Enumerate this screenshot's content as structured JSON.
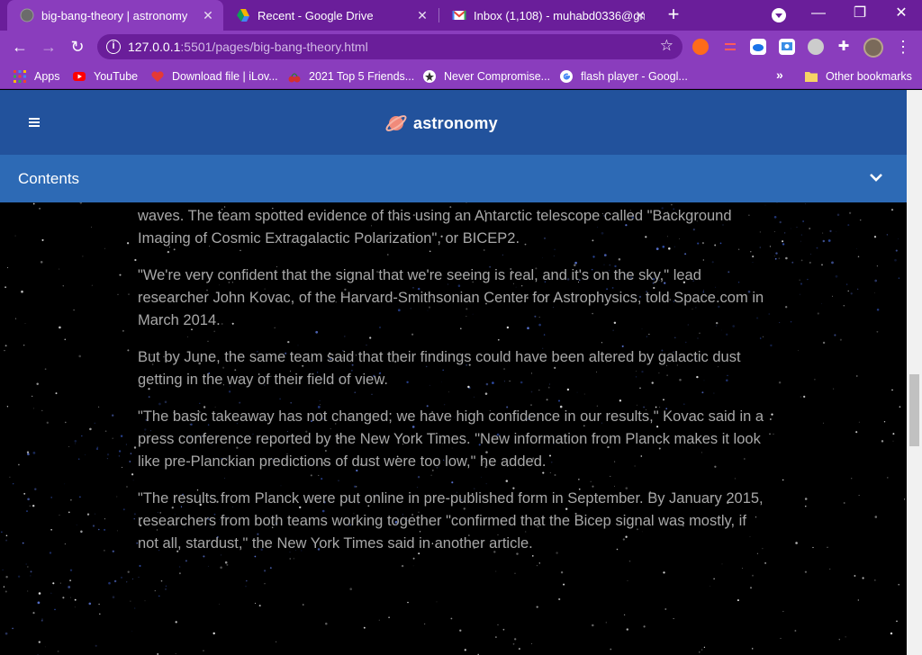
{
  "browser": {
    "tabs": [
      {
        "title": "big-bang-theory | astronomy",
        "active": true,
        "icon": "globe-icon"
      },
      {
        "title": "Recent - Google Drive",
        "active": false,
        "icon": "google-drive-icon"
      },
      {
        "title": "Inbox (1,108) - muhabd0336@gm",
        "active": false,
        "icon": "gmail-icon"
      }
    ],
    "url_host": "127.0.0.1",
    "url_rest": ":5501/pages/big-bang-theory.html",
    "bookmarks": [
      {
        "label": "Apps",
        "icon": "apps-grid-icon"
      },
      {
        "label": "YouTube",
        "icon": "youtube-icon"
      },
      {
        "label": "Download file | iLov...",
        "icon": "heart-icon"
      },
      {
        "label": "2021 Top 5 Friends...",
        "icon": "cherries-icon"
      },
      {
        "label": "Never Compromise...",
        "icon": "badge-icon"
      },
      {
        "label": "flash player - Googl...",
        "icon": "google-icon"
      }
    ],
    "other_bookmarks": "Other bookmarks",
    "colors": {
      "tabstrip": "#6a1e9a",
      "toolbar": "#8a3dbd"
    }
  },
  "site": {
    "brand": "astronomy",
    "contents_label": "Contents",
    "colors": {
      "header": "#22529c",
      "contents_bar": "#2d6ab5"
    }
  },
  "article": {
    "paragraphs": [
      "waves. The team spotted evidence of this using an Antarctic telescope called \"Background Imaging of Cosmic Extragalactic Polarization\", or BICEP2.",
      "\"We're very confident that the signal that we're seeing is real, and it's on the sky,\" lead researcher John Kovac, of the Harvard-Smithsonian Center for Astrophysics, told Space.com in March 2014.",
      "But by June, the same team said that their findings could have been altered by galactic dust getting in the way of their field of view.",
      "\"The basic takeaway has not changed; we have high confidence in our results,\" Kovac said in a press conference reported by the New York Times. \"New information from Planck makes it look like pre-Planckian predictions of dust were too low,\" he added.",
      "\"The results from Planck were put online in pre-published form in September. By January 2015, researchers from both teams working together \"confirmed that the Bicep signal was mostly, if not all, stardust,\" the New York Times said in another article."
    ]
  }
}
